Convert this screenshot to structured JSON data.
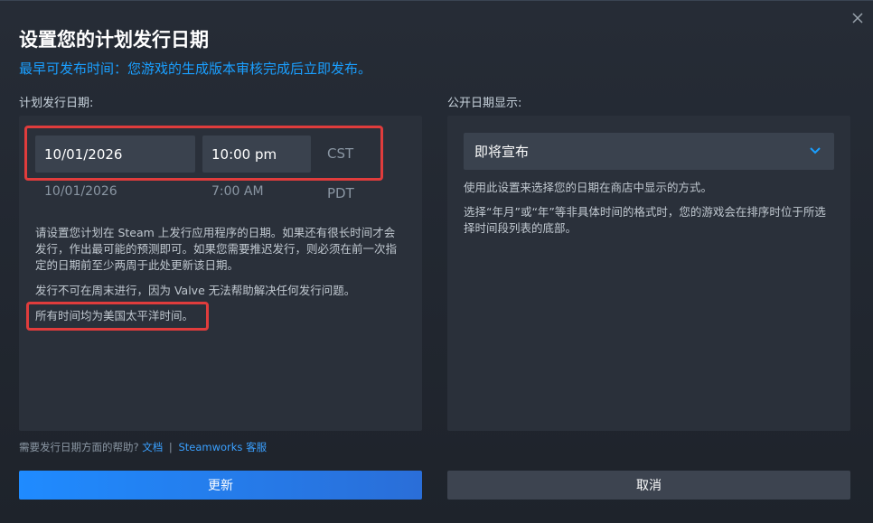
{
  "dialog": {
    "title": "设置您的计划发行日期",
    "subtitle": "最早可发布时间：您游戏的生成版本审核完成后立即发布。"
  },
  "left": {
    "label": "计划发行日期:",
    "date_value": "10/01/2026",
    "time_value": "10:00 pm",
    "timezone": "CST",
    "converted_date": "10/01/2026",
    "converted_time": "7:00 AM",
    "converted_timezone": "PDT",
    "para1": "请设置您计划在 Steam 上发行应用程序的日期。如果还有很长时间才会发行，作出最可能的预测即可。如果您需要推迟发行，则必须在前一次指定的日期前至少两周于此处更新该日期。",
    "para2": "发行不可在周末进行，因为 Valve 无法帮助解决任何发行问题。",
    "para3": "所有时间均为美国太平洋时间。"
  },
  "right": {
    "label": "公开日期显示:",
    "dropdown_value": "即将宣布",
    "desc1": "使用此设置来选择您的日期在商店中显示的方式。",
    "desc2": "选择“年月”或“年”等非具体时间的格式时，您的游戏会在排序时位于所选择时间段列表的底部。"
  },
  "help": {
    "prefix": "需要发行日期方面的帮助?",
    "docs_link": "文档",
    "separator": "|",
    "support_link": "Steamworks 客服"
  },
  "buttons": {
    "update": "更新",
    "cancel": "取消"
  },
  "colors": {
    "accent": "#1a9fff",
    "highlight": "#e03c3c"
  },
  "icons": {
    "close": "close-icon",
    "dropdown": "chevron-down-icon"
  }
}
